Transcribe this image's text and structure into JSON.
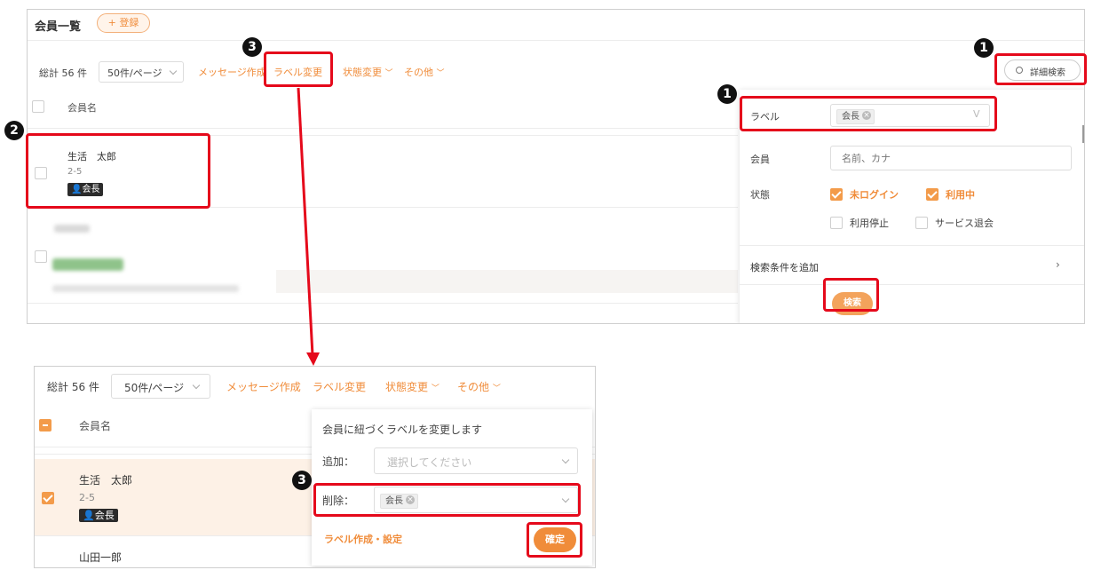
{
  "upper": {
    "title": "会員一覧",
    "register_button": "+ 登録",
    "toolbar": {
      "total": "総計 56 件",
      "per_page": "50件/ページ",
      "message": "メッセージ作成",
      "label_change": "ラベル変更",
      "status_change": "状態変更",
      "other": "その他"
    },
    "detail_search_button": "詳細検索",
    "column_header": "会員名",
    "member": {
      "name": "生活　太郎",
      "room": "2-5",
      "badge": "会長"
    },
    "search_panel": {
      "label_field_label": "ラベル",
      "label_tag": "会長",
      "member_field_label": "会員",
      "member_placeholder": "名前、カナ",
      "status_label": "状態",
      "status_options": [
        {
          "label": "未ログイン",
          "checked": true
        },
        {
          "label": "利用中",
          "checked": true
        },
        {
          "label": "利用停止",
          "checked": false
        },
        {
          "label": "サービス退会",
          "checked": false
        }
      ],
      "add_condition": "検索条件を追加",
      "search_button": "検索"
    }
  },
  "lower": {
    "toolbar": {
      "total": "総計 56 件",
      "per_page": "50件/ページ",
      "message": "メッセージ作成",
      "label_change": "ラベル変更",
      "status_change": "状態変更",
      "other": "その他"
    },
    "column_header": "会員名",
    "member1": {
      "name": "生活　太郎",
      "room": "2-5",
      "badge": "会長"
    },
    "member2": {
      "name": "山田一郎"
    },
    "popover": {
      "title": "会員に紐づくラベルを変更します",
      "add_label": "追加：",
      "add_placeholder": "選択してください",
      "delete_label": "削除：",
      "delete_tag": "会長",
      "create_link": "ラベル作成・設定",
      "confirm_button": "確定"
    }
  },
  "markers": {
    "m1": "1",
    "m2": "2",
    "m3": "3"
  },
  "colors": {
    "accent": "#f08c3a",
    "highlight": "#e5091b",
    "selected_row": "#fdf1e6"
  }
}
